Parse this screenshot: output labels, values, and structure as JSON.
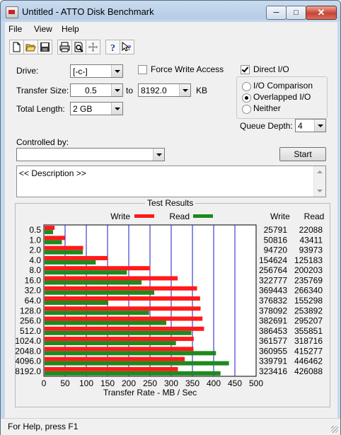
{
  "window": {
    "title": "Untitled - ATTO Disk Benchmark"
  },
  "menu": [
    "File",
    "View",
    "Help"
  ],
  "toolbar_icons": [
    "new-icon",
    "open-icon",
    "save-icon",
    "print-icon",
    "print-preview-icon",
    "move-icon",
    "help-icon",
    "context-help-icon"
  ],
  "settings": {
    "drive_label": "Drive:",
    "drive_value": "[-c-]",
    "force_write_label": "Force Write Access",
    "force_write_checked": false,
    "direct_io_label": "Direct I/O",
    "direct_io_checked": true,
    "transfer_size_label": "Transfer Size:",
    "transfer_from": "0.5",
    "to_label": "to",
    "transfer_to": "8192.0",
    "kb_label": "KB",
    "total_length_label": "Total Length:",
    "total_length_value": "2 GB",
    "io_options": [
      {
        "label": "I/O Comparison",
        "selected": false
      },
      {
        "label": "Overlapped I/O",
        "selected": true
      },
      {
        "label": "Neither",
        "selected": false
      }
    ],
    "queue_depth_label": "Queue Depth:",
    "queue_depth_value": "4",
    "controlled_by_label": "Controlled by:",
    "controlled_by_value": "",
    "start_label": "Start",
    "description_text": "<< Description >>"
  },
  "results": {
    "title": "Test Results",
    "legend_write": "Write",
    "legend_read": "Read",
    "col_write": "Write",
    "col_read": "Read",
    "xlabel": "Transfer Rate - MB / Sec",
    "colors": {
      "write": "#ff1a1a",
      "read": "#1e8a1e",
      "grid": "#1a1ac8"
    }
  },
  "chart_data": {
    "type": "bar",
    "orientation": "horizontal",
    "title": "Test Results",
    "xlabel": "Transfer Rate - MB / Sec",
    "xlim": [
      0,
      500
    ],
    "xticks": [
      0,
      50,
      100,
      150,
      200,
      250,
      300,
      350,
      400,
      450,
      500
    ],
    "categories": [
      "0.5",
      "1.0",
      "2.0",
      "4.0",
      "8.0",
      "16.0",
      "32.0",
      "64.0",
      "128.0",
      "256.0",
      "512.0",
      "1024.0",
      "2048.0",
      "4096.0",
      "8192.0"
    ],
    "series": [
      {
        "name": "Write",
        "values": [
          25.2,
          49.6,
          92.5,
          151.1,
          250.8,
          315.2,
          360.8,
          368.0,
          369.2,
          373.7,
          377.4,
          353.1,
          352.5,
          331.8,
          315.8
        ]
      },
      {
        "name": "Read",
        "values": [
          21.6,
          42.4,
          91.8,
          122.2,
          195.5,
          230.2,
          260.1,
          151.7,
          247.9,
          288.4,
          347.5,
          311.2,
          405.5,
          436.0,
          416.1
        ]
      }
    ],
    "table": {
      "write": [
        "25791",
        "50816",
        "94720",
        "154624",
        "256764",
        "322777",
        "369443",
        "376832",
        "378092",
        "382691",
        "386453",
        "361577",
        "360955",
        "339791",
        "323416"
      ],
      "read": [
        "22088",
        "43411",
        "93973",
        "125183",
        "200203",
        "235769",
        "266340",
        "155298",
        "253892",
        "295207",
        "355851",
        "318716",
        "415277",
        "446462",
        "426088"
      ]
    }
  },
  "status": {
    "text": "For Help, press F1"
  }
}
